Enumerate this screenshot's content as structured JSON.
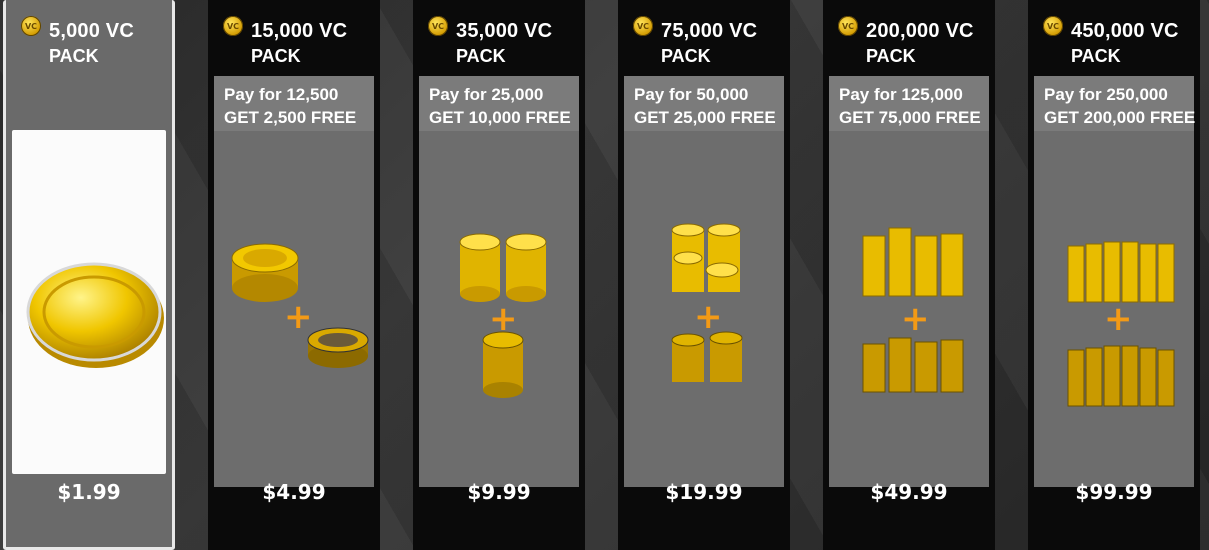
{
  "colors": {
    "accent": "#f39a16",
    "coin": "#f2c500",
    "panel": "#0a0a0a",
    "offer_bg": "#7b7b7b",
    "body_bg": "#6d6d6d"
  },
  "packs": [
    {
      "amount": "5,000 VC",
      "pack": "PACK",
      "offer_line1": "",
      "offer_line2": "",
      "price": "$1.99",
      "badge": "VC",
      "selected": true
    },
    {
      "amount": "15,000 VC",
      "pack": "PACK",
      "offer_line1": "Pay for 12,500",
      "offer_line2": "GET 2,500 FREE",
      "price": "$4.99",
      "badge": "VC",
      "selected": false
    },
    {
      "amount": "35,000 VC",
      "pack": "PACK",
      "offer_line1": "Pay for 25,000",
      "offer_line2": "GET 10,000 FREE",
      "price": "$9.99",
      "badge": "VC",
      "selected": false
    },
    {
      "amount": "75,000 VC",
      "pack": "PACK",
      "offer_line1": "Pay for 50,000",
      "offer_line2": "GET 25,000 FREE",
      "price": "$19.99",
      "badge": "VC",
      "selected": false
    },
    {
      "amount": "200,000 VC",
      "pack": "PACK",
      "offer_line1": "Pay for 125,000",
      "offer_line2": "GET 75,000 FREE",
      "price": "$49.99",
      "badge": "VC",
      "selected": false
    },
    {
      "amount": "450,000 VC",
      "pack": "PACK",
      "offer_line1": "Pay for 250,000",
      "offer_line2": "GET 200,000 FREE",
      "price": "$99.99",
      "badge": "VC",
      "selected": false
    }
  ],
  "plus_symbol": "+",
  "coin_label": "VC"
}
